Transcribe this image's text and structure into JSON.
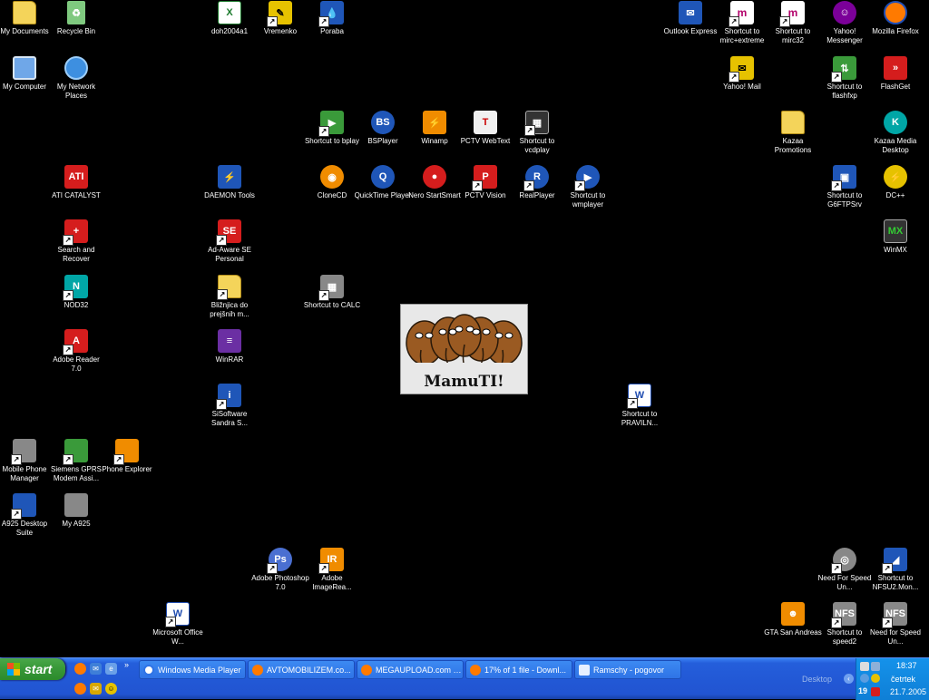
{
  "desktop": {
    "icons": {
      "my_documents": "My Documents",
      "recycle_bin": "Recycle Bin",
      "my_computer": "My Computer",
      "my_network_places": "My Network Places",
      "ati_catalyst": "ATI CATALYST",
      "search_and_recover": "Search and Recover",
      "nod32": "NOD32",
      "adobe_reader": "Adobe Reader 7.0",
      "mobile_phone_manager": "Mobile Phone Manager",
      "siemens_gprs": "Siemens GPRS Modem Assi...",
      "phone_explorer": "Phone Explorer",
      "a925_desktop_suite": "A925 Desktop Suite",
      "my_a925": "My A925",
      "microsoft_office": "Microsoft Office W...",
      "doh2004a1": "doh2004a1",
      "vremenko": "Vremenko",
      "poraba": "Poraba",
      "daemon_tools": "DAEMON Tools",
      "ad_aware": "Ad-Aware SE Personal",
      "bliznjica": "Bližnjica do prejšnih m...",
      "winrar": "WinRAR",
      "sisoftware": "SiSoftware Sandra S...",
      "shortcut_bplay": "Shortcut to bplay",
      "bsplayer": "BSPlayer",
      "winamp": "Winamp",
      "pctv_webtext": "PCTV WebText",
      "shortcut_vcdplay": "Shortcut to vcdplay",
      "clonecd": "CloneCD",
      "quicktime": "QuickTime Player",
      "nero": "Nero StartSmart",
      "pctv_vision": "PCTV Vision",
      "realplayer": "RealPlayer",
      "shortcut_wmplayer": "Shortcut to wmplayer",
      "shortcut_calc": "Shortcut to CALC",
      "shortcut_praviln": "Shortcut to PRAVILN...",
      "photoshop": "Adobe Photoshop 7.0",
      "imageready": "Adobe ImageRea...",
      "outlook_express": "Outlook Express",
      "shortcut_mirc_extreme": "Shortcut to mirc+extreme",
      "shortcut_mirc32": "Shortcut to mirc32",
      "yahoo_messenger": "Yahoo! Messenger",
      "firefox": "Mozilla Firefox",
      "yahoo_mail": "Yahoo! Mail",
      "shortcut_flashfxp": "Shortcut to flashfxp",
      "flashget": "FlashGet",
      "kazaa_promotions": "Kazaa Promotions",
      "kazaa_media": "Kazaa Media Desktop",
      "shortcut_g6ftpsrv": "Shortcut to G6FTPSrv",
      "dcpp": "DC++",
      "winmx": "WinMX",
      "nfs_underground": "Need For Speed Un...",
      "shortcut_nfsu2": "Shortcut to NFSU2.Mon...",
      "gta_san_andreas": "GTA San Andreas",
      "shortcut_speed2": "Shortcut to speed2",
      "nfs_underground2": "Need for Speed Un..."
    },
    "wallpaper_text": "MamuTI!"
  },
  "taskbar": {
    "start_label": "start",
    "windows": [
      "Windows Media Player",
      "AVTOMOBILIZEM.co...",
      "MEGAUPLOAD.com - ...",
      "17% of 1 file - Downl...",
      "Ramschy - pogovor"
    ],
    "desktop_toolbar": "Desktop",
    "tray": {
      "time": "18:37",
      "day": "četrtek",
      "date": "21.7.2005",
      "ati_badge": "19"
    }
  },
  "colors": {
    "desktop_bg": "#000000",
    "taskbar_blue": "#245edb",
    "start_green": "#3a9a3a",
    "tray_blue": "#0f7fd6"
  }
}
